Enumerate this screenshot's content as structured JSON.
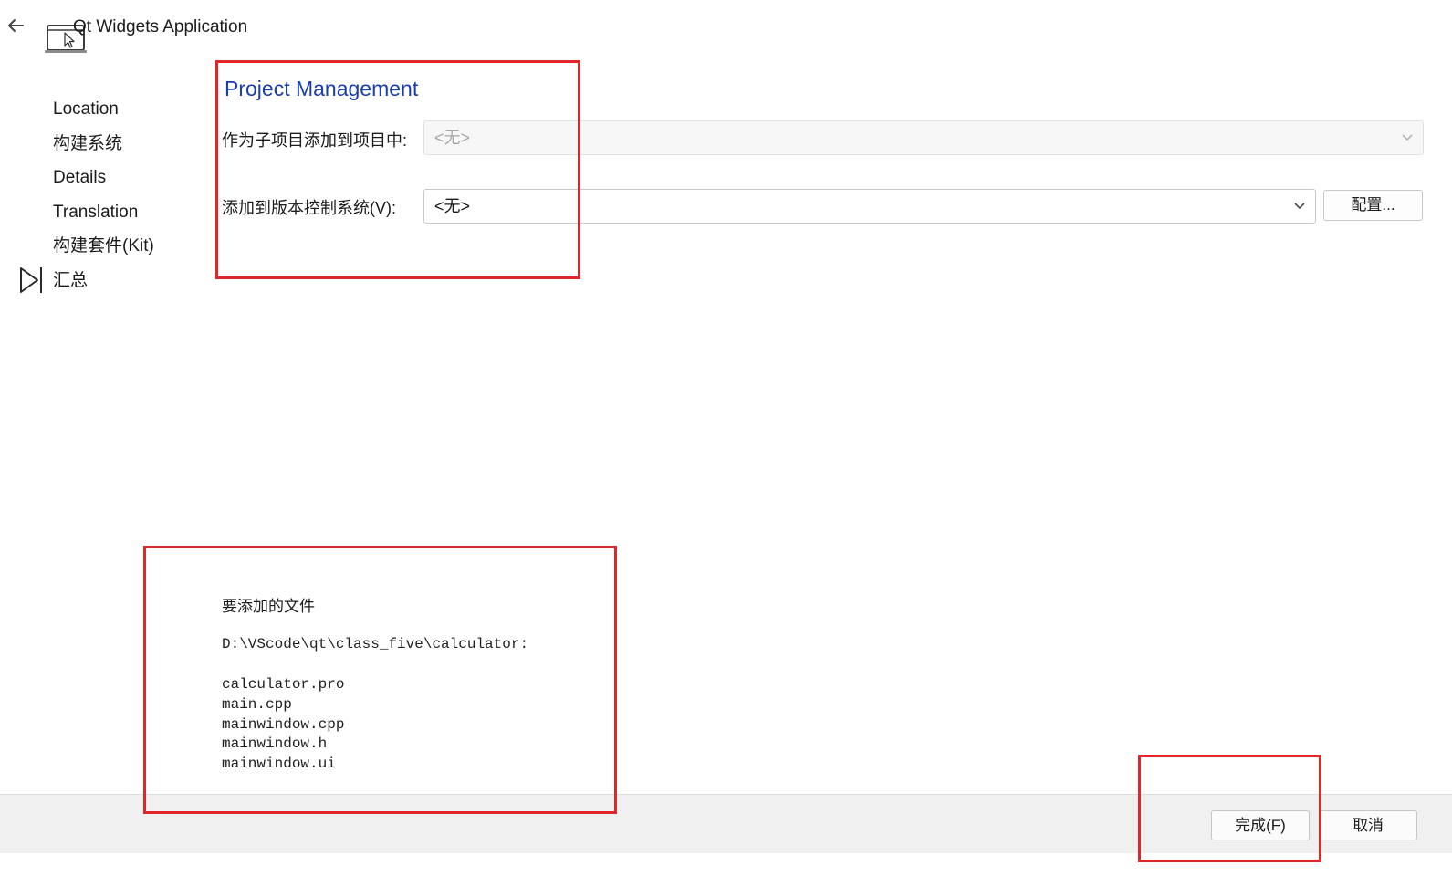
{
  "header": {
    "title": "Qt Widgets Application",
    "back_icon": "arrow-left-icon",
    "app_icon": "app-window-cursor-icon"
  },
  "steps": {
    "items": [
      {
        "label": "Location"
      },
      {
        "label": "构建系统"
      },
      {
        "label": "Details"
      },
      {
        "label": "Translation"
      },
      {
        "label": "构建套件(Kit)"
      },
      {
        "label": "汇总"
      }
    ],
    "current_index": 5,
    "current_marker_icon": "play-triangle-icon"
  },
  "project_management": {
    "title": "Project Management",
    "subproject_label": "作为子项目添加到项目中:",
    "subproject_value": "<无>",
    "vcs_label": "添加到版本控制系统(V):",
    "vcs_value": "<无>",
    "configure_label": "配置..."
  },
  "files": {
    "heading": "要添加的文件",
    "directory": "D:\\VScode\\qt\\class_five\\calculator:",
    "list": [
      "calculator.pro",
      "main.cpp",
      "mainwindow.cpp",
      "mainwindow.h",
      "mainwindow.ui"
    ]
  },
  "footer": {
    "finish_label": "完成(F)",
    "cancel_label": "取消"
  },
  "colors": {
    "section_title": "#1a3eaa",
    "annotation_red": "#e0252b",
    "footer_bg": "#f0f0f0"
  }
}
